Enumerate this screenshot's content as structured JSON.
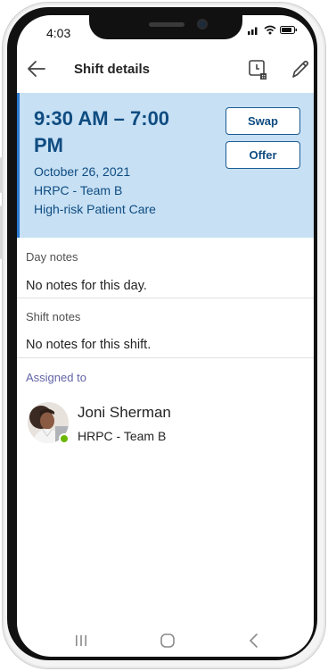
{
  "status_bar": {
    "time": "4:03"
  },
  "header": {
    "title": "Shift details"
  },
  "shift": {
    "time_range": "9:30 AM – 7:00 PM",
    "date": "October 26, 2021",
    "team": "HRPC - Team B",
    "label": "High-risk Patient Care",
    "swap_label": "Swap",
    "offer_label": "Offer"
  },
  "day_notes": {
    "label": "Day notes",
    "text": "No notes for this day."
  },
  "shift_notes": {
    "label": "Shift notes",
    "text": "No notes for this shift."
  },
  "assigned": {
    "label": "Assigned to",
    "name": "Joni Sherman",
    "team": "HRPC - Team B",
    "presence": "available"
  },
  "colors": {
    "card_background": "#c7e0f4",
    "card_accent": "#0f4c81",
    "assigned_label": "#6264a7",
    "presence_available": "#6bb700"
  },
  "icons": {
    "back": "arrow-left-icon",
    "time_off": "calendar-clock-icon",
    "edit": "pencil-icon",
    "nav_recents": "recents-icon",
    "nav_home": "home-icon",
    "nav_back": "chevron-left-icon"
  }
}
